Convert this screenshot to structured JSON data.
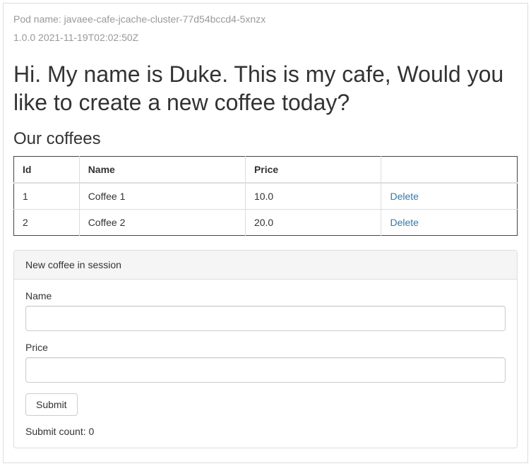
{
  "header": {
    "pod_name": "Pod name: javaee-cafe-jcache-cluster-77d54bccd4-5xnzx",
    "version_info": "1.0.0 2021-11-19T02:02:50Z"
  },
  "main": {
    "greeting": "Hi. My name is Duke. This is my cafe, Would you like to create a new coffee today?",
    "coffees_heading": "Our coffees"
  },
  "table": {
    "headers": {
      "id": "Id",
      "name": "Name",
      "price": "Price",
      "actions": ""
    },
    "rows": [
      {
        "id": "1",
        "name": "Coffee 1",
        "price": "10.0",
        "delete": "Delete"
      },
      {
        "id": "2",
        "name": "Coffee 2",
        "price": "20.0",
        "delete": "Delete"
      }
    ]
  },
  "form": {
    "panel_title": "New coffee in session",
    "name_label": "Name",
    "name_value": "",
    "price_label": "Price",
    "price_value": "",
    "submit_label": "Submit",
    "submit_count": "Submit count: 0"
  }
}
